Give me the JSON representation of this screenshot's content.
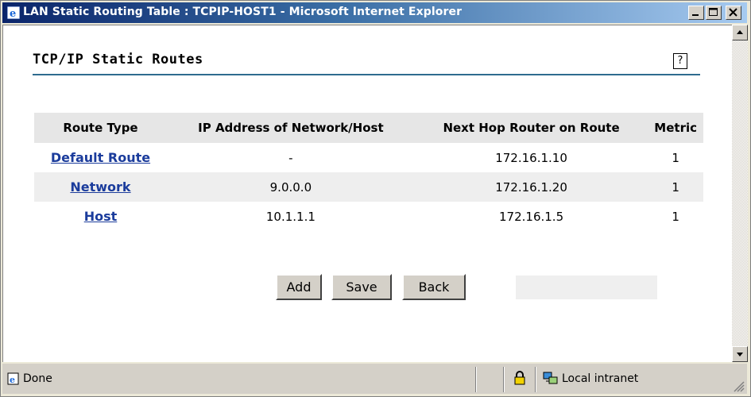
{
  "window": {
    "title": "LAN Static Routing Table : TCPIP-HOST1 - Microsoft Internet Explorer",
    "icon": "ie-icon",
    "controls": [
      "minimize-icon",
      "maximize-icon",
      "close-icon"
    ]
  },
  "page": {
    "heading": "TCP/IP Static Routes",
    "help_label": "?"
  },
  "table": {
    "headers": [
      "Route Type",
      "IP Address of Network/Host",
      "Next Hop Router on Route",
      "Metric"
    ],
    "rows": [
      {
        "route_type": "Default Route",
        "ip": "-",
        "next_hop": "172.16.1.10",
        "metric": "1"
      },
      {
        "route_type": "Network",
        "ip": "9.0.0.0",
        "next_hop": "172.16.1.20",
        "metric": "1"
      },
      {
        "route_type": "Host",
        "ip": "10.1.1.1",
        "next_hop": "172.16.1.5",
        "metric": "1"
      }
    ]
  },
  "buttons": {
    "add": "Add",
    "save": "Save",
    "back": "Back"
  },
  "status": {
    "left": "Done",
    "zone": "Local intranet",
    "icons": [
      "page-done-icon",
      "lock-icon",
      "intranet-icon"
    ]
  },
  "colors": {
    "link": "#1b3c9c",
    "rule": "#2f6c8f",
    "titlebar_start": "#0a246a",
    "titlebar_end": "#a6caf0"
  }
}
